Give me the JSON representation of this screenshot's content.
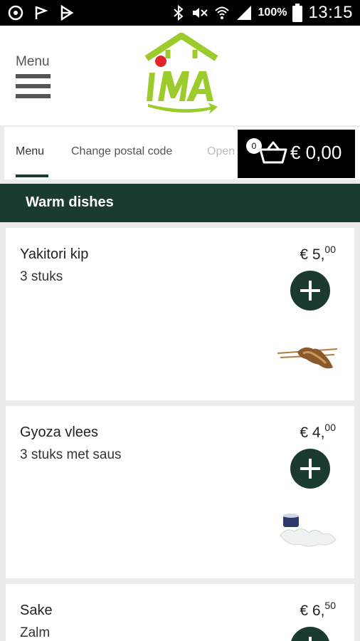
{
  "status_bar": {
    "battery": "100%",
    "time": "13:15"
  },
  "header": {
    "menu_label": "Menu",
    "logo_text": "IMA"
  },
  "tabs": [
    {
      "label": "Menu",
      "active": true
    },
    {
      "label": "Change postal code",
      "active": false
    },
    {
      "label": "Open",
      "active": false
    }
  ],
  "cart": {
    "count": "0",
    "total": "€ 0,00"
  },
  "section": {
    "title": "Warm dishes"
  },
  "dishes": [
    {
      "name": "Yakitori kip",
      "description": "3 stuks",
      "price_main": "€ 5,",
      "price_cents": "00"
    },
    {
      "name": "Gyoza vlees",
      "description": "3 stuks met saus",
      "price_main": "€ 4,",
      "price_cents": "00"
    },
    {
      "name": "Sake",
      "description": "Zalm",
      "price_main": "€ 6,",
      "price_cents": "50"
    }
  ],
  "colors": {
    "brand_dark": "#1b3b30",
    "logo_green": "#9bcc2c",
    "logo_red": "#e0262a"
  }
}
